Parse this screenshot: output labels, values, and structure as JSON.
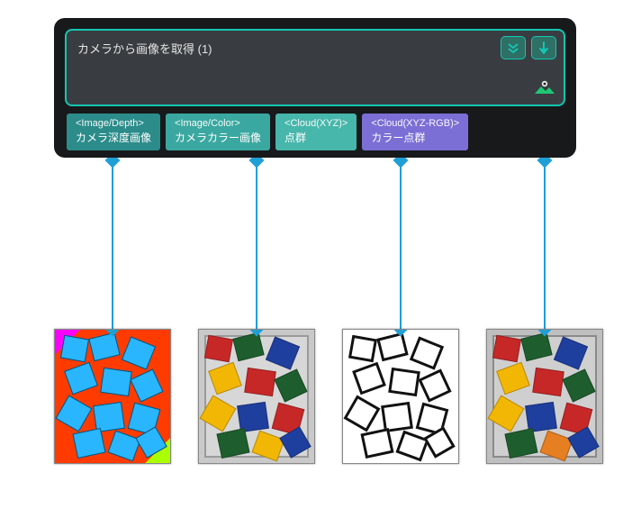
{
  "node": {
    "title": "カメラから画像を取得 (1)",
    "buttons": {
      "expand": "expand",
      "run": "run"
    }
  },
  "ports": [
    {
      "type": "<Image/Depth>",
      "label": "カメラ深度画像"
    },
    {
      "type": "<Image/Color>",
      "label": "カメラカラー画像"
    },
    {
      "type": "<Cloud(XYZ)>",
      "label": "点群"
    },
    {
      "type": "<Cloud(XYZ-RGB)>",
      "label": "カラー点群"
    }
  ],
  "thumbnails": [
    {
      "kind": "depth",
      "alt": "Depth image false-color preview"
    },
    {
      "kind": "color",
      "alt": "RGB camera image preview"
    },
    {
      "kind": "xyz",
      "alt": "XYZ point cloud preview"
    },
    {
      "kind": "xyz-rgb",
      "alt": "Colored XYZ-RGB point cloud preview"
    }
  ],
  "colors": {
    "accent": "#14c5b0",
    "connector": "#1f9fd6",
    "port_purple": "#7b6fd5"
  }
}
